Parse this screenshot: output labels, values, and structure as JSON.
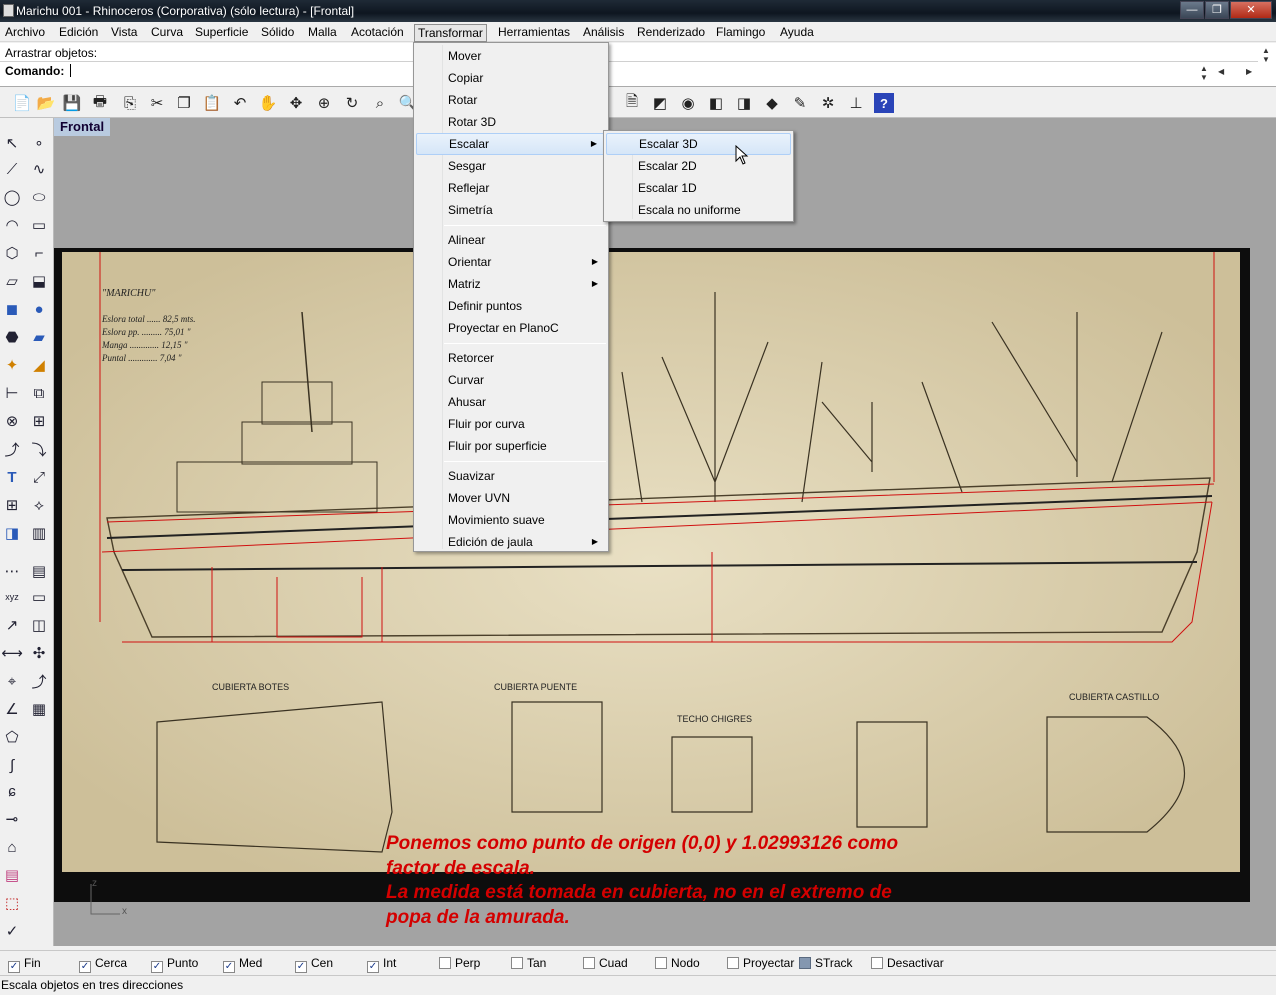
{
  "window": {
    "title": "Marichu 001 - Rhinoceros (Corporativa) (sólo lectura) - [Frontal]",
    "buttons": [
      "—",
      "❐",
      "✕"
    ]
  },
  "menubar": [
    "Archivo",
    "Edición",
    "Vista",
    "Curva",
    "Superficie",
    "Sólido",
    "Malla",
    "Acotación",
    "Transformar",
    "Herramientas",
    "Análisis",
    "Renderizado",
    "Flamingo",
    "Ayuda"
  ],
  "command": {
    "history": "Arrastrar objetos:",
    "prompt_label": "Comando:"
  },
  "viewport": {
    "name": "Frontal",
    "overlay_text": "Ponemos como punto de origen (0,0) y 1.02993126 como\nfactor de escala.\nLa medida está tomada en cubierta, no en el extremo de\npopa de la amurada.",
    "axis_x": "x",
    "axis_z": "z"
  },
  "blueprint": {
    "ship_name": "\"MARICHU\"",
    "specs": [
      "Eslora total ...... 82,5 mts.",
      "Eslora pp. ......... 75,01 \"",
      "Manga ............. 12,15 \"",
      "Puntal ............. 7,04 \""
    ],
    "plan_labels": [
      "CUBIERTA BOTES",
      "CUBIERTA PUENTE",
      "TECHO CHIGRES",
      "CUBIERTA CASTILLO"
    ]
  },
  "transform_menu": {
    "groups": [
      [
        {
          "label": "Mover"
        },
        {
          "label": "Copiar"
        },
        {
          "label": "Rotar"
        },
        {
          "label": "Rotar 3D"
        },
        {
          "label": "Escalar",
          "submenu": true,
          "highlighted": true
        },
        {
          "label": "Sesgar"
        },
        {
          "label": "Reflejar"
        },
        {
          "label": "Simetría"
        }
      ],
      [
        {
          "label": "Alinear"
        },
        {
          "label": "Orientar",
          "submenu": true
        },
        {
          "label": "Matriz",
          "submenu": true
        },
        {
          "label": "Definir puntos"
        },
        {
          "label": "Proyectar en PlanoC"
        }
      ],
      [
        {
          "label": "Retorcer"
        },
        {
          "label": "Curvar"
        },
        {
          "label": "Ahusar"
        },
        {
          "label": "Fluir por curva"
        },
        {
          "label": "Fluir por superficie"
        }
      ],
      [
        {
          "label": "Suavizar"
        },
        {
          "label": "Mover UVN"
        },
        {
          "label": "Movimiento suave"
        },
        {
          "label": "Edición de jaula",
          "submenu": true
        }
      ]
    ]
  },
  "scale_submenu": [
    {
      "label": "Escalar 3D",
      "highlighted": true
    },
    {
      "label": "Escalar 2D"
    },
    {
      "label": "Escalar 1D"
    },
    {
      "label": "Escala no uniforme"
    }
  ],
  "osnaps": [
    {
      "label": "Fin",
      "checked": true
    },
    {
      "label": "Cerca",
      "checked": true
    },
    {
      "label": "Punto",
      "checked": true
    },
    {
      "label": "Med",
      "checked": true
    },
    {
      "label": "Cen",
      "checked": true
    },
    {
      "label": "Int",
      "checked": true
    },
    {
      "label": "Perp",
      "checked": false
    },
    {
      "label": "Tan",
      "checked": false
    },
    {
      "label": "Cuad",
      "checked": false
    },
    {
      "label": "Nodo",
      "checked": false
    },
    {
      "label": "Proyectar",
      "checked": false
    },
    {
      "label": "STrack",
      "checked": false,
      "filled": true
    },
    {
      "label": "Desactivar",
      "checked": false
    }
  ],
  "status": "Escala objetos en tres direcciones",
  "icons": {
    "top_toolbar": [
      "new-icon",
      "open-icon",
      "save-icon",
      "print-icon",
      "import-icon",
      "cut-icon",
      "copy-icon",
      "paste-icon",
      "undo-icon",
      "pan-icon",
      "move-view-icon",
      "zoom-icon",
      "zoom-window-icon",
      "zoom-extents-icon",
      "zoom-selected-icon",
      "properties-icon",
      "layer-icon",
      "color-icon",
      "render-icon",
      "material-icon",
      "light-icon",
      "sun-icon",
      "help-icon"
    ],
    "left_toolbar": [
      "select-icon",
      "point-icon",
      "polyline-icon",
      "curve-icon",
      "circle-icon",
      "ellipse-icon",
      "arc-icon",
      "rectangle-icon",
      "polygon-icon",
      "fillet-icon",
      "surface-icon",
      "extrude-icon",
      "box-icon",
      "sphere-icon",
      "mesh-icon",
      "transform-icon",
      "boolean-icon",
      "explode-icon",
      "text-icon",
      "dimension-icon",
      "array-icon",
      "edit-points-icon",
      "analyze-icon",
      "render-icon"
    ]
  },
  "colors": {
    "menu_highlight": "#d6e6f8",
    "overlay_text": "#d40000",
    "viewport_tab": "#b9cbe0",
    "viewport_bg": "#a3a3a3"
  }
}
